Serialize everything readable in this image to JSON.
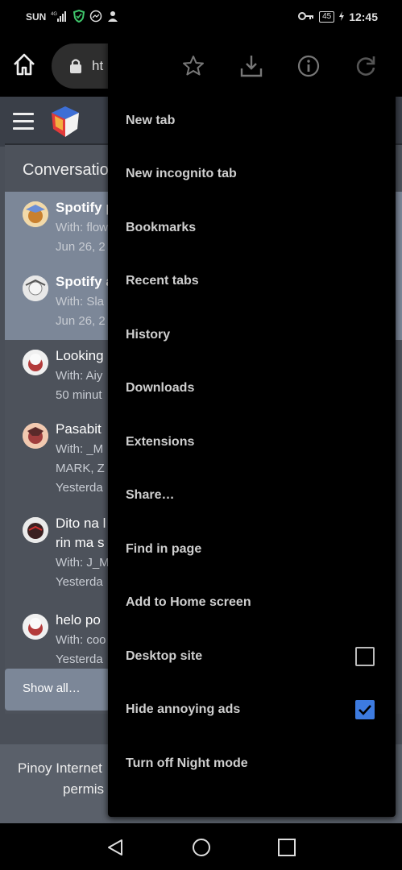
{
  "status_bar": {
    "carrier": "SUN",
    "network": "4G",
    "battery": "45",
    "time": "12:45",
    "icons": [
      "signal-icon",
      "shield-icon",
      "messenger-icon",
      "person-icon",
      "key-icon",
      "battery-icon",
      "charging-icon"
    ]
  },
  "toolbar": {
    "url_text": "ht",
    "icons": [
      "home-icon",
      "lock-icon"
    ]
  },
  "site": {
    "panel_title": "Conversatio",
    "conversations": [
      {
        "title": "Spotify p",
        "line1": "With: flow",
        "line2": "Jun 26, 2",
        "highlight": true
      },
      {
        "title": "Spotify a",
        "line1": "With: Sla",
        "line2": "Jun 26, 2",
        "highlight": true
      },
      {
        "title": "Looking",
        "line1": "With: Aiy",
        "line2": "50 minut",
        "highlight": false
      },
      {
        "title": "Pasabit",
        "line1": "With: _M",
        "line2": "MARK, Z",
        "line3": "Yesterda",
        "highlight": false
      },
      {
        "title": "Dito na l",
        "title2": "rin ma s",
        "line1": "With: J_M",
        "line2": "Yesterda",
        "highlight": false
      },
      {
        "title": "helo po",
        "line1": "With: coo",
        "line2": "Yesterda",
        "highlight": false
      }
    ],
    "show_all": "Show all…",
    "footer_line1": "Pinoy Internet",
    "footer_line2": "permis"
  },
  "menu": {
    "top_icons": [
      "star-icon",
      "download-icon",
      "info-icon",
      "refresh-icon"
    ],
    "items": [
      {
        "label": "New tab"
      },
      {
        "label": "New incognito tab"
      },
      {
        "label": "Bookmarks"
      },
      {
        "label": "Recent tabs"
      },
      {
        "label": "History"
      },
      {
        "label": "Downloads"
      },
      {
        "label": "Extensions"
      },
      {
        "label": "Share…"
      },
      {
        "label": "Find in page"
      },
      {
        "label": "Add to Home screen"
      },
      {
        "label": "Desktop site",
        "checkbox": false
      },
      {
        "label": "Hide annoying ads",
        "checkbox": true
      },
      {
        "label": "Turn off Night mode"
      }
    ]
  },
  "colors": {
    "accent_check": "#3d7be0",
    "page_bg": "#4a4f58",
    "highlight_row": "#7c8798",
    "menu_bg": "#000000"
  },
  "nav_bar": {
    "icons": [
      "back-icon",
      "home-circle-icon",
      "recents-icon"
    ]
  }
}
